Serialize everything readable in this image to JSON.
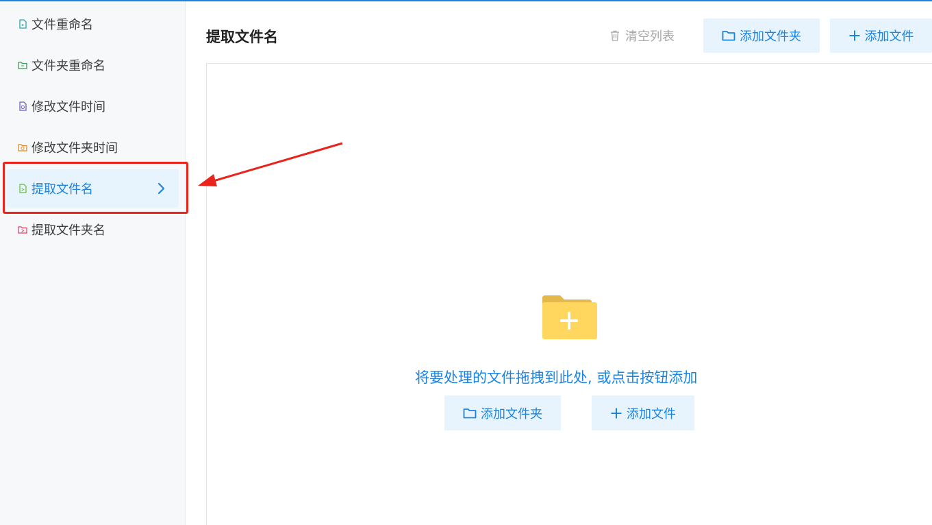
{
  "sidebar": {
    "items": [
      {
        "label": "文件重命名",
        "icon": "file-rename-icon",
        "color": "#2aa3b8"
      },
      {
        "label": "文件夹重命名",
        "icon": "folder-rename-icon",
        "color": "#3a9b5c"
      },
      {
        "label": "修改文件时间",
        "icon": "file-time-icon",
        "color": "#6b5ec9"
      },
      {
        "label": "修改文件夹时间",
        "icon": "folder-time-icon",
        "color": "#e08a2a"
      },
      {
        "label": "提取文件名",
        "icon": "extract-filename-icon",
        "color": "#6cbf3a",
        "active": true
      },
      {
        "label": "提取文件夹名",
        "icon": "extract-foldername-icon",
        "color": "#e0456a"
      }
    ]
  },
  "main": {
    "title": "提取文件名",
    "toolbar": {
      "clear_label": "清空列表",
      "add_folder_label": "添加文件夹",
      "add_file_label": "添加文件"
    },
    "dropzone": {
      "hint": "将要处理的文件拖拽到此处, 或点击按钮添加",
      "add_folder_label": "添加文件夹",
      "add_file_label": "添加文件"
    }
  },
  "colors": {
    "accent": "#1a84e0",
    "active_bg": "#e7f3fd",
    "highlight": "#e8241c",
    "folder": "#ffd75e"
  }
}
